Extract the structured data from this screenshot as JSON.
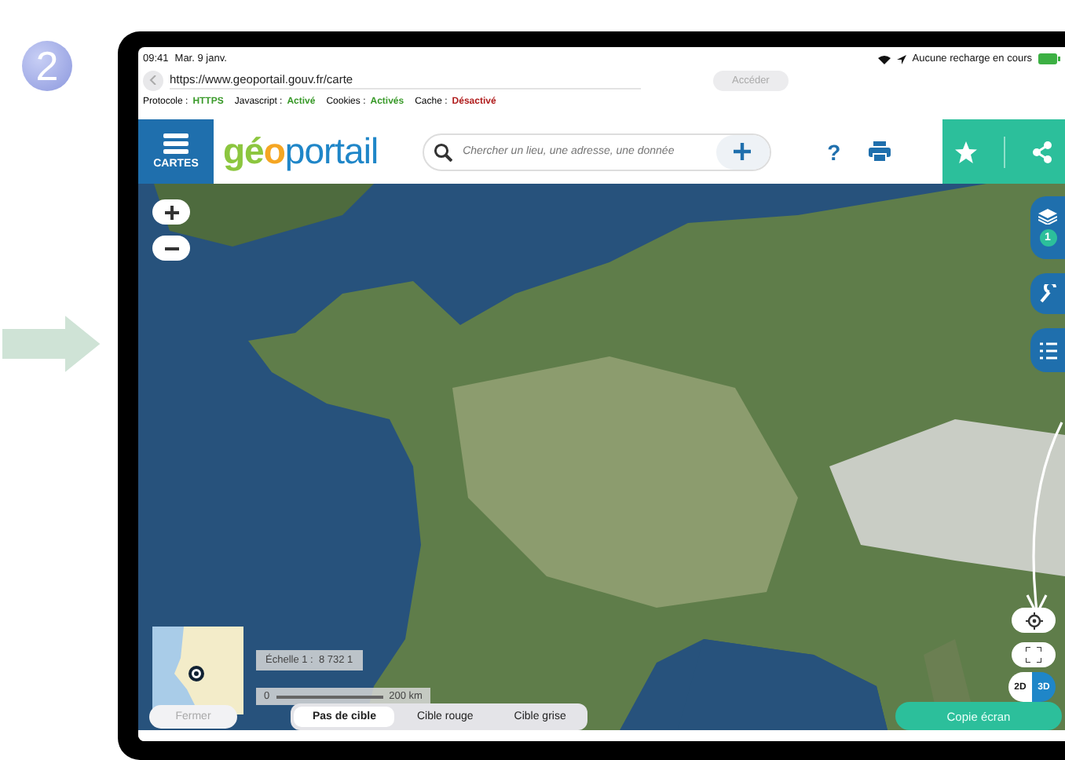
{
  "step": "2",
  "status_bar": {
    "time": "09:41",
    "date": "Mar. 9 janv.",
    "charging": "Aucune recharge en cours"
  },
  "browser": {
    "url": "https://www.geoportail.gouv.fr/carte",
    "go_button": {
      "label": "Accéder",
      "disabled": true
    },
    "protocol_info": [
      {
        "label": "Protocole :",
        "value": "HTTPS",
        "color": "#3a9a2a"
      },
      {
        "label": "Javascript :",
        "value": "Activé",
        "color": "#3a9a2a"
      },
      {
        "label": "Cookies :",
        "value": "Activés",
        "color": "#3a9a2a"
      },
      {
        "label": "Cache :",
        "value": "Désactivé",
        "color": "#b01c1c"
      }
    ]
  },
  "header": {
    "menu_label": "CARTES",
    "logo": [
      {
        "text": "gé",
        "color": "#8cc63f"
      },
      {
        "text": "o",
        "color": "#f5a623"
      },
      {
        "text": "portail",
        "color": "#1f86c8"
      }
    ],
    "search_placeholder": "Chercher un lieu, une adresse, une donnée",
    "help": "?"
  },
  "map": {
    "layers_count": "1",
    "scale": "Échelle 1 :  8 732 1",
    "scale_start": "0",
    "scale_end": "200 km",
    "view_modes": [
      "2D",
      "3D"
    ]
  },
  "bottom": {
    "close_button": {
      "label": "Fermer",
      "disabled": true
    },
    "targets": [
      {
        "label": "Pas de cible",
        "selected": true
      },
      {
        "label": "Cible rouge",
        "selected": false
      },
      {
        "label": "Cible grise",
        "selected": false
      }
    ],
    "capture_button": "Copie écran"
  }
}
